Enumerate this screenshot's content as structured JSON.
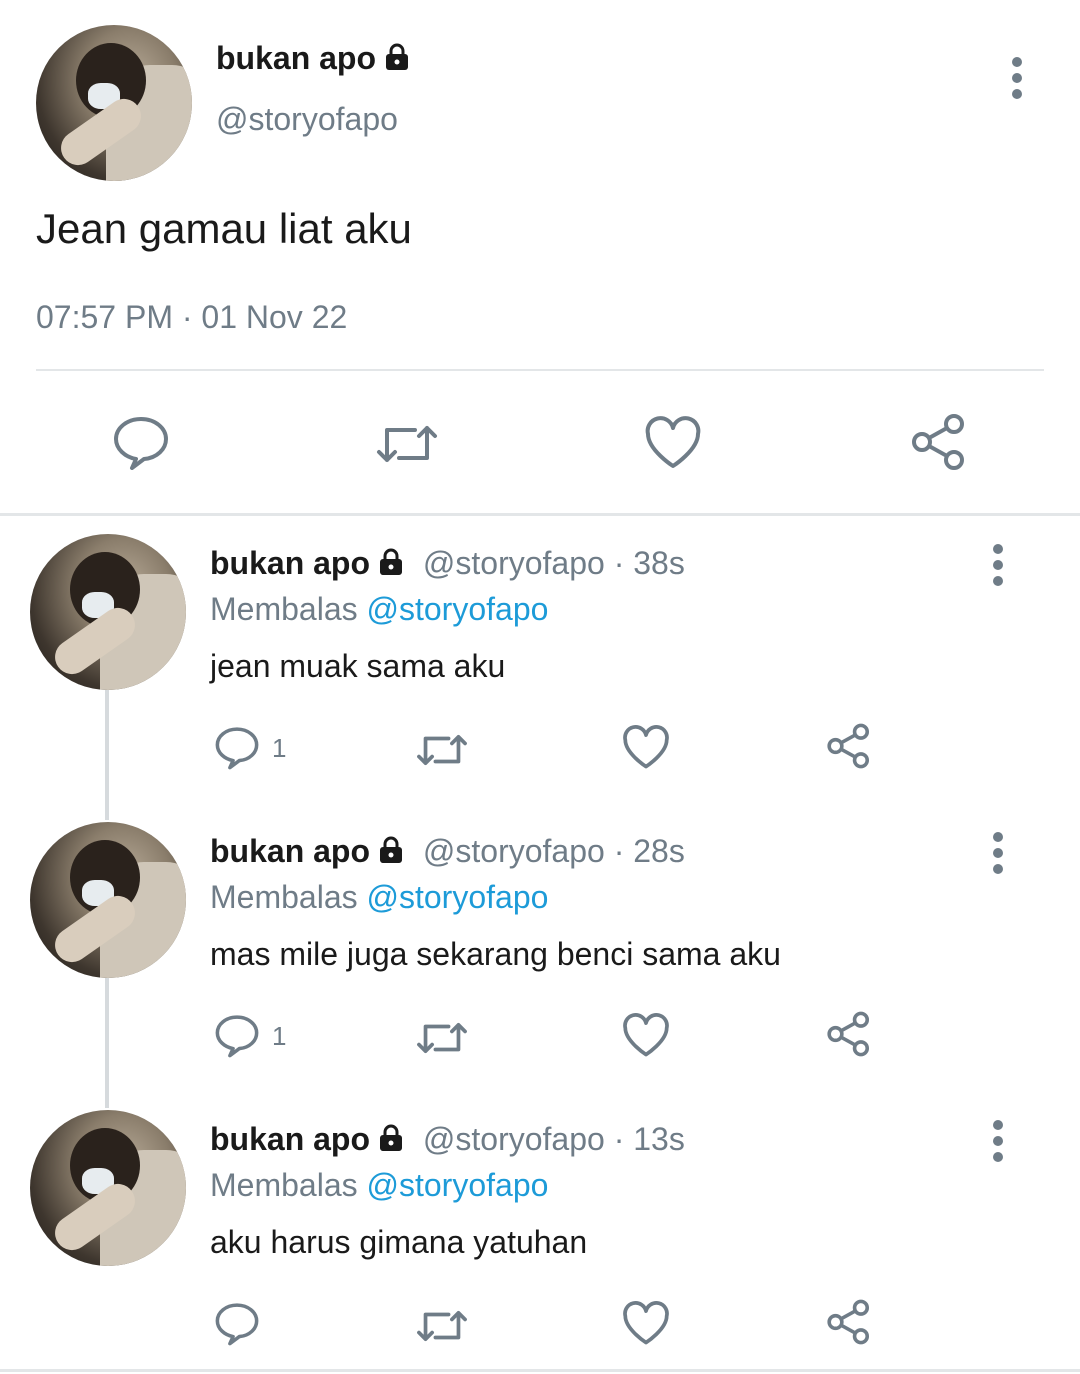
{
  "tweet": {
    "name": "bukan apo",
    "handle": "@storyofapo",
    "text": "Jean gamau liat aku",
    "timestamp": "07:57 PM · 01 Nov 22"
  },
  "replies": [
    {
      "name": "bukan apo",
      "handle_time": "@storyofapo · 38s",
      "replying_label": "Membalas",
      "mention": "@storyofapo",
      "text": "jean muak sama aku",
      "reply_count": "1"
    },
    {
      "name": "bukan apo",
      "handle_time": "@storyofapo · 28s",
      "replying_label": "Membalas",
      "mention": "@storyofapo",
      "text": "mas mile juga sekarang benci sama aku",
      "reply_count": "1"
    },
    {
      "name": "bukan apo",
      "handle_time": "@storyofapo · 13s",
      "replying_label": "Membalas",
      "mention": "@storyofapo",
      "text": "aku harus gimana yatuhan",
      "reply_count": ""
    }
  ],
  "icons": {
    "reply": "speech-bubble-icon",
    "retweet": "retweet-icon",
    "like": "heart-icon",
    "share": "share-icon",
    "menu": "more-vertical-icon",
    "protected": "lock-icon"
  },
  "colors": {
    "text": "#1a1a1a",
    "muted": "#6f7c87",
    "link": "#1d9bd8",
    "divider": "#e3e6e8"
  }
}
